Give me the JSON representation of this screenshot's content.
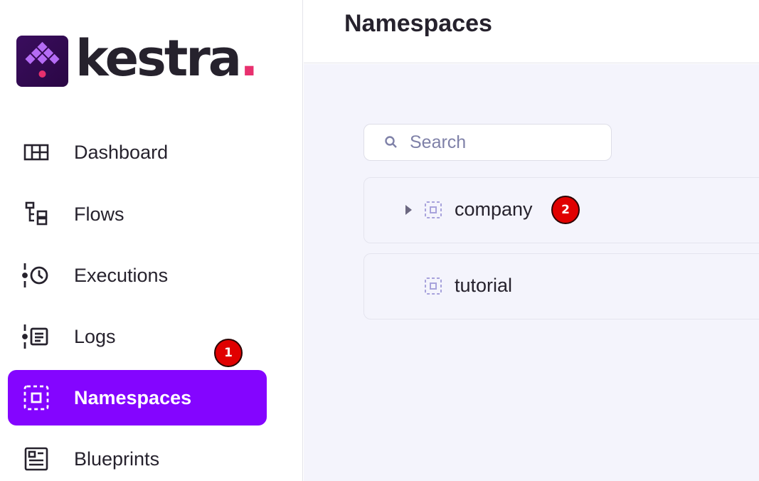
{
  "brand": {
    "name": "kestra",
    "dot": ".",
    "accent": "#8405ff",
    "dot_color": "#e8306e"
  },
  "sidebar": {
    "items": [
      {
        "label": "Dashboard",
        "icon": "dashboard-icon"
      },
      {
        "label": "Flows",
        "icon": "flows-icon"
      },
      {
        "label": "Executions",
        "icon": "executions-icon"
      },
      {
        "label": "Logs",
        "icon": "logs-icon"
      },
      {
        "label": "Namespaces",
        "icon": "namespaces-icon",
        "active": true
      },
      {
        "label": "Blueprints",
        "icon": "blueprints-icon"
      }
    ]
  },
  "header": {
    "title": "Namespaces"
  },
  "search": {
    "placeholder": "Search",
    "value": ""
  },
  "namespaces": [
    {
      "label": "company",
      "expandable": true
    },
    {
      "label": "tutorial",
      "expandable": false
    }
  ],
  "annotations": {
    "badge_1": "1",
    "badge_2": "2"
  }
}
